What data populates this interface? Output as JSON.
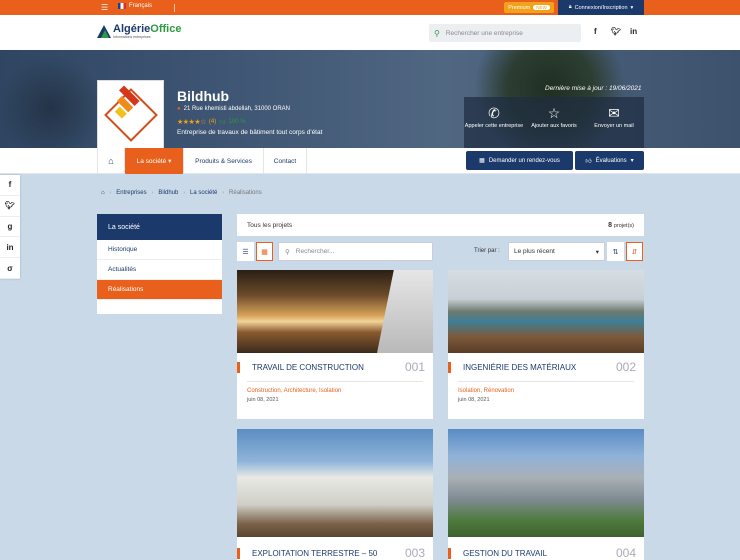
{
  "topbar": {
    "language": "Français",
    "premium_label": "Premium",
    "premium_pill": "NEW",
    "login_label": "Connexion/Inscription"
  },
  "header": {
    "logo_main": "Algérie",
    "logo_accent": "Office",
    "logo_tagline": "Informations entreprises",
    "search_placeholder": "Rechercher une entreprise"
  },
  "company": {
    "name": "Bildhub",
    "address": "21 Rue khemisti abdellah, 31000 ORAN",
    "stars": "★★★★☆",
    "rating_count": "(4)",
    "recommend": "100 %",
    "description": "Entreprise de travaux de bâtiment tout corps d'état",
    "updated": "Dernière mise à jour : 19/06/2021"
  },
  "actions": [
    {
      "icon": "phone-icon",
      "glyph": "✆",
      "label": "Appeler cette entreprise"
    },
    {
      "icon": "star-icon",
      "glyph": "☆",
      "label": "Ajouter aux favoris"
    },
    {
      "icon": "mail-icon",
      "glyph": "✉",
      "label": "Envoyer un mail"
    }
  ],
  "nav": {
    "home_glyph": "⌂",
    "society": "La société",
    "products": "Produits & Services",
    "contact": "Contact",
    "appointment": "Demander un rendez-vous",
    "reviews": "Évaluations"
  },
  "breadcrumb": [
    "Entreprises",
    "Bildhub",
    "La société",
    "Réalisations"
  ],
  "sidemenu": {
    "title": "La société",
    "items": [
      "Historique",
      "Actualités",
      "Réalisations"
    ]
  },
  "projects": {
    "heading": "Tous les projets",
    "count": "8",
    "count_unit": "projet(s)",
    "search_placeholder": "Rechercher...",
    "sort_label": "Trier par :",
    "sort_value": "Le plus récent",
    "items": [
      {
        "title": "TRAVAIL DE CONSTRUCTION",
        "num": "001",
        "cats": "Construction, Architecture, Isolation",
        "date": "juin 08, 2021"
      },
      {
        "title": "INGENIÉRIE DES MATÉRIAUX",
        "num": "002",
        "cats": "Isolation, Rénovation",
        "date": "juin 08, 2021"
      },
      {
        "title": "EXPLOITATION TERRESTRE – 50",
        "num": "003",
        "cats": "",
        "date": ""
      },
      {
        "title": "GESTION DU TRAVAIL",
        "num": "004",
        "cats": "",
        "date": ""
      }
    ]
  },
  "colors": {
    "accent": "#e8601c",
    "navy": "#1b3a6b",
    "green": "#2d9b3e",
    "background": "#c9d9e8"
  }
}
